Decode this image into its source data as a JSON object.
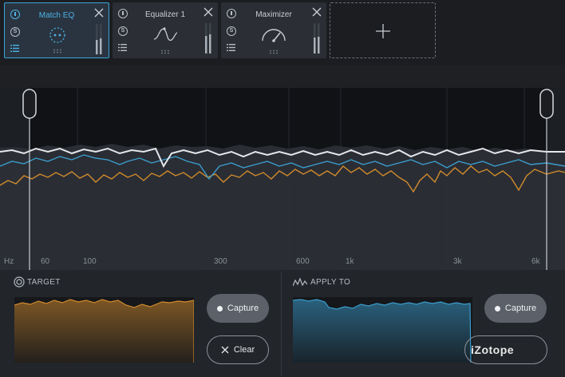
{
  "modules": [
    {
      "name": "Match EQ",
      "solo": "S",
      "icon": "match-eq-icon",
      "active": true
    },
    {
      "name": "Equalizer 1",
      "solo": "S",
      "icon": "eq-curve-icon",
      "active": false
    },
    {
      "name": "Maximizer",
      "solo": "S",
      "icon": "gauge-icon",
      "active": false
    }
  ],
  "add_module": {
    "icon": "plus-icon"
  },
  "spectrum": {
    "unit_label": "Hz",
    "freq_labels": [
      "60",
      "100",
      "300",
      "600",
      "1k",
      "3k",
      "6k"
    ],
    "colors": {
      "white_curve": "#e6e8eb",
      "blue_curve": "#3b9ccc",
      "orange_curve": "#d08a2c"
    }
  },
  "target": {
    "title": "TARGET",
    "icon": "target-icon",
    "capture_label": "Capture",
    "clear_label": "Clear",
    "color": "#d08a2c"
  },
  "apply_to": {
    "title": "APPLY TO",
    "icon": "waveform-icon",
    "capture_label": "Capture",
    "color": "#3b9ccc"
  },
  "watermark": "iZotope"
}
